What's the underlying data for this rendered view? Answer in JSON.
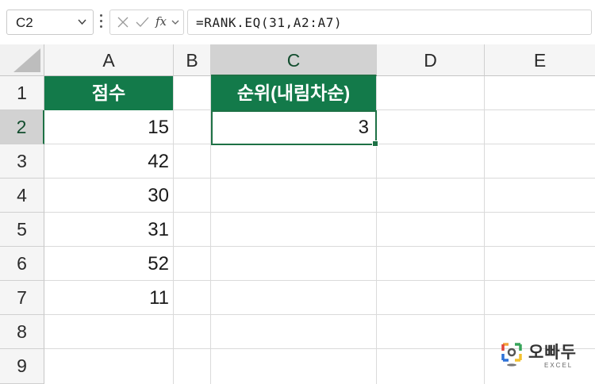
{
  "formula_bar": {
    "name_box": "C2",
    "fx_label": "fx",
    "formula": "=RANK.EQ(31,A2:A7)"
  },
  "columns": [
    "A",
    "B",
    "C",
    "D",
    "E"
  ],
  "rows": [
    "1",
    "2",
    "3",
    "4",
    "5",
    "6",
    "7",
    "8",
    "9"
  ],
  "cells": {
    "A1": "점수",
    "C1": "순위(내림차순)",
    "A2": "15",
    "A3": "42",
    "A4": "30",
    "A5": "31",
    "A6": "52",
    "A7": "11",
    "C2": "3"
  },
  "selection": {
    "active_cell": "C2",
    "column": "C",
    "row": "2"
  },
  "colors": {
    "header_fill": "#137a4a",
    "selection": "#1e7145"
  },
  "watermark": {
    "brand": "오빠두",
    "sub": "EXCEL"
  }
}
